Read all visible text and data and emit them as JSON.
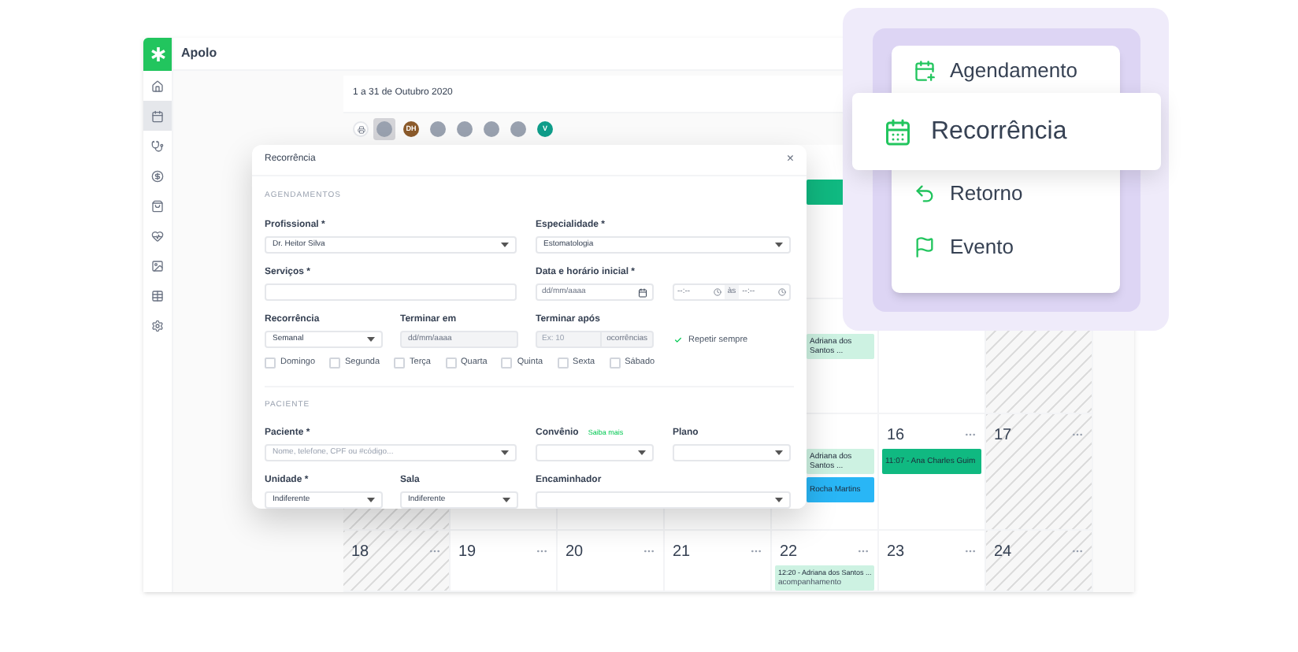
{
  "app": {
    "title": "Apolo"
  },
  "sidebar": {
    "items": [
      {
        "kind": "home",
        "selected": false
      },
      {
        "kind": "calendar",
        "selected": true
      },
      {
        "kind": "stethoscope",
        "selected": false
      },
      {
        "kind": "dollar",
        "selected": false
      },
      {
        "kind": "bag",
        "selected": false
      },
      {
        "kind": "heart",
        "selected": false
      },
      {
        "kind": "image",
        "selected": false
      },
      {
        "kind": "table",
        "selected": false
      },
      {
        "kind": "settings",
        "selected": false
      }
    ]
  },
  "calendar": {
    "range": "1 a 31 de Outubro 2020",
    "avatars": [
      {
        "kind": "photo",
        "selected": true
      },
      {
        "kind": "initials",
        "initials": "DH",
        "color": "#8b5a2b",
        "selected": false
      },
      {
        "kind": "photo",
        "selected": false
      },
      {
        "kind": "photo",
        "selected": false
      },
      {
        "kind": "photo",
        "selected": false
      },
      {
        "kind": "photo",
        "selected": false
      },
      {
        "kind": "initials",
        "initials": "V",
        "color": "#0f9d8a",
        "selected": false
      }
    ],
    "weeks": [
      {
        "days": [
          {
            "weekend": false,
            "events": [
              {
                "color": "#10b981"
              }
            ]
          }
        ]
      },
      {
        "days": [
          {
            "weekend": false,
            "events": [
              {
                "title": "Adriana dos Santos ...",
                "color": "#cdf2e2"
              }
            ]
          },
          {
            "weekend": false
          },
          {
            "weekend": true
          }
        ]
      },
      {
        "days": [
          {
            "weekend": true
          },
          {
            "weekend": false
          },
          {
            "weekend": false
          },
          {
            "weekend": false
          },
          {
            "weekend": false,
            "events": [
              {
                "title": "Adriana dos Santos ...",
                "color": "#cdf2e2"
              },
              {
                "title": "Rocha Martins",
                "color": "#29b6f6"
              }
            ]
          },
          {
            "number": "16",
            "weekend": false,
            "events": [
              {
                "title": "11:07 - Ana Charles Guim",
                "color": "#10b981"
              }
            ]
          },
          {
            "number": "17",
            "weekend": true
          }
        ]
      },
      {
        "days": [
          {
            "number": "18",
            "weekend": true
          },
          {
            "number": "19",
            "weekend": false
          },
          {
            "number": "20",
            "weekend": false
          },
          {
            "number": "21",
            "weekend": false
          },
          {
            "number": "22",
            "weekend": false,
            "events": [
              {
                "title": "12:20 - Adriana dos Santos ...",
                "detail": "acompanhamento",
                "color": "#cdf2e2"
              }
            ]
          },
          {
            "number": "23",
            "weekend": false
          },
          {
            "number": "24",
            "weekend": true
          }
        ]
      }
    ]
  },
  "modal": {
    "title": "Recorrência",
    "close": "×",
    "section_1": "AGENDAMENTOS",
    "profissional": {
      "label": "Profissional *",
      "value": "Dr. Heitor Silva"
    },
    "especialidade": {
      "label": "Especialidade *",
      "value": "Estomatologia"
    },
    "servicos": {
      "label": "Serviços *"
    },
    "data": {
      "label": "Data e horário inicial *",
      "placeholder": "dd/mm/aaaa",
      "time_start": "--:--",
      "separator": "às",
      "time_end": "--:--"
    },
    "recorrencia": {
      "label": "Recorrência",
      "value": "Semanal"
    },
    "terminar_em": {
      "label": "Terminar em",
      "placeholder": "dd/mm/aaaa",
      "disabled": true
    },
    "terminar_apos": {
      "label": "Terminar após",
      "placeholder": "Ex: 10",
      "suffix": "ocorrências",
      "disabled": true
    },
    "repetir": {
      "label": "Repetir sempre",
      "checked": true
    },
    "days": [
      {
        "label": "Domingo",
        "checked": false
      },
      {
        "label": "Segunda",
        "checked": false
      },
      {
        "label": "Terça",
        "checked": false
      },
      {
        "label": "Quarta",
        "checked": false
      },
      {
        "label": "Quinta",
        "checked": false
      },
      {
        "label": "Sexta",
        "checked": false
      },
      {
        "label": "Sábado",
        "checked": false
      }
    ],
    "section_2": "PACIENTE",
    "paciente": {
      "label": "Paciente *",
      "placeholder": "Nome, telefone, CPF ou #código..."
    },
    "convenio": {
      "label": "Convênio",
      "link": "Saiba mais"
    },
    "plano": {
      "label": "Plano"
    },
    "unidade": {
      "label": "Unidade *",
      "value": "Indiferente"
    },
    "sala": {
      "label": "Sala",
      "value": "Indiferente"
    },
    "encaminhador": {
      "label": "Encaminhador"
    }
  },
  "menu": {
    "items": [
      {
        "kind": "calendar-plus",
        "label": "Agendamento",
        "selected": false
      },
      {
        "kind": "calendar",
        "label": "Recorrência",
        "selected": true
      },
      {
        "kind": "undo",
        "label": "Retorno",
        "selected": false
      },
      {
        "kind": "flag",
        "label": "Evento",
        "selected": false
      }
    ]
  }
}
